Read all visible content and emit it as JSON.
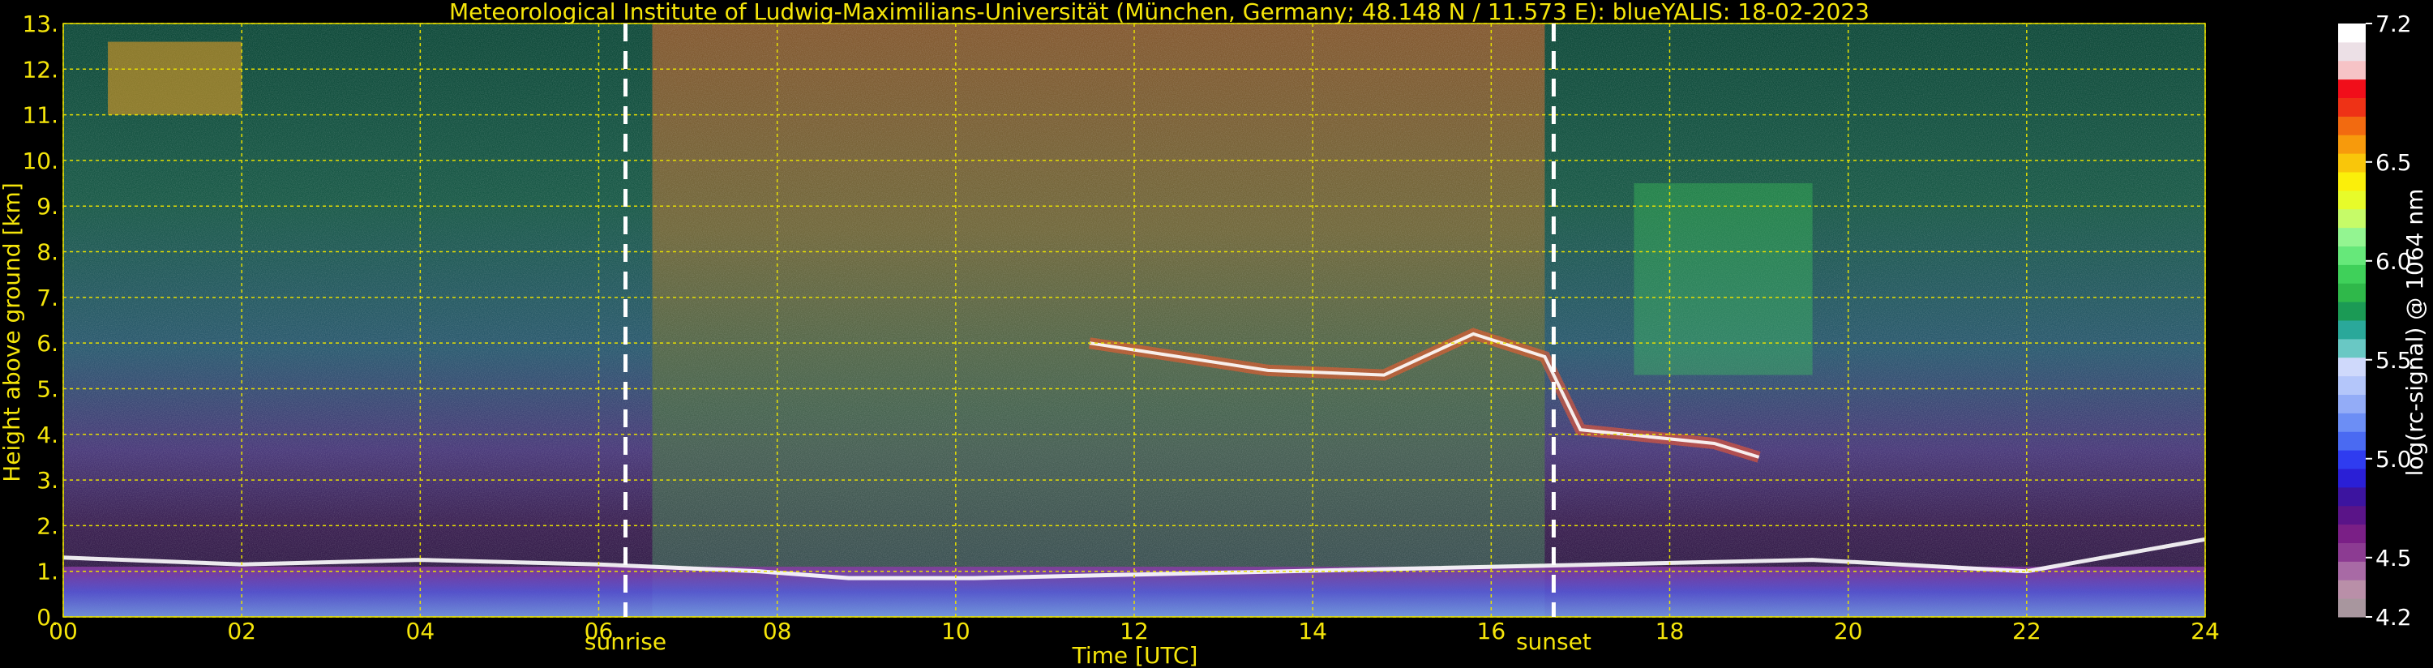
{
  "chart_data": {
    "type": "heatmap",
    "title": "Meteorological Institute of Ludwig-Maximilians-Universität (München, Germany; 48.148 N / 11.573 E):     blueYALIS: 18-02-2023",
    "xlabel": "Time [UTC]",
    "ylabel": "Height above ground [km]",
    "xlim": [
      0,
      24
    ],
    "ylim": [
      0,
      13
    ],
    "x_ticks": [
      "00",
      "02",
      "04",
      "06",
      "08",
      "10",
      "12",
      "14",
      "16",
      "18",
      "20",
      "22",
      "24"
    ],
    "y_ticks": [
      "0.",
      "1.",
      "2.",
      "3.",
      "4.",
      "5.",
      "6.",
      "7.",
      "8.",
      "9.",
      "10.",
      "11.",
      "12.",
      "13."
    ],
    "grid": true,
    "markers": [
      {
        "label": "sunrise",
        "x": 6.3
      },
      {
        "label": "sunset",
        "x": 16.7
      }
    ],
    "colorbar": {
      "label": "log(rc-signal) @ 1064 nm",
      "range": [
        4.2,
        7.2
      ],
      "tick_labels": [
        "7.2",
        "6.5",
        "6.0",
        "5.5",
        "5.0",
        "4.5",
        "4.2"
      ],
      "tick_values": [
        7.2,
        6.5,
        6.0,
        5.5,
        5.0,
        4.5,
        4.2
      ],
      "colors": [
        "#a8969e",
        "#b98fa8",
        "#a86aa5",
        "#8c3b92",
        "#7a1f86",
        "#5a1488",
        "#3c149f",
        "#2a1fd6",
        "#2f3cf0",
        "#4a6af2",
        "#6c8ef5",
        "#93acf7",
        "#b4c6fa",
        "#cfd9fb",
        "#69c8c4",
        "#2aa89a",
        "#1b9a55",
        "#2fb84a",
        "#3fd05a",
        "#66e87a",
        "#93f591",
        "#c6fb68",
        "#e7fb2a",
        "#fbef0a",
        "#f9c60a",
        "#f79a0c",
        "#f26a10",
        "#ee3216",
        "#f10e1a",
        "#f6c3c6",
        "#ece0e6",
        "#ffffff"
      ]
    },
    "cloud_base_height_km": [
      {
        "t": 0.0,
        "h": 1.3
      },
      {
        "t": 2.0,
        "h": 1.15
      },
      {
        "t": 4.0,
        "h": 1.25
      },
      {
        "t": 6.0,
        "h": 1.15
      },
      {
        "t": 7.8,
        "h": 1.0
      },
      {
        "t": 8.8,
        "h": 0.85
      },
      {
        "t": 10.2,
        "h": 0.85
      },
      {
        "t": 19.6,
        "h": 1.25
      },
      {
        "t": 22.0,
        "h": 1.0
      },
      {
        "t": 24.0,
        "h": 1.7
      }
    ],
    "elevated_layer_km": [
      {
        "t": 11.5,
        "h": 6.0
      },
      {
        "t": 13.5,
        "h": 5.4
      },
      {
        "t": 14.8,
        "h": 5.3
      },
      {
        "t": 15.8,
        "h": 6.2
      },
      {
        "t": 16.6,
        "h": 5.7
      },
      {
        "t": 17.0,
        "h": 4.1
      },
      {
        "t": 18.5,
        "h": 3.8
      },
      {
        "t": 19.0,
        "h": 3.5
      }
    ]
  }
}
